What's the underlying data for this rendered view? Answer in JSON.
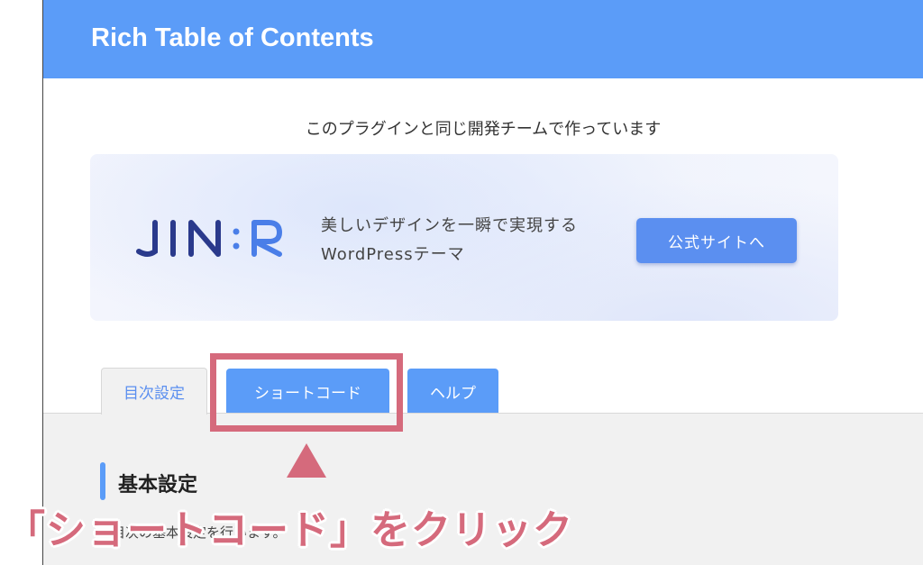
{
  "header": {
    "title": "Rich Table of Contents"
  },
  "promo": {
    "made_by": "このプラグインと同じ開発チームで作っています",
    "logo": {
      "text": "JIN:R",
      "colors": [
        "#2a3a8c",
        "#4a7ee8"
      ]
    },
    "tagline_line1": "美しいデザインを一瞬で実現する",
    "tagline_line2": "WordPressテーマ",
    "button_label": "公式サイトへ"
  },
  "tabs": [
    {
      "label": "目次設定",
      "active": true
    },
    {
      "label": "ショートコード",
      "active": false
    },
    {
      "label": "ヘルプ",
      "active": false
    }
  ],
  "section": {
    "title": "基本設定",
    "description": "目次の基本設定を行います。"
  },
  "annotation": {
    "instruction": "「ショートコード」をクリック",
    "color": "#d56a7c"
  },
  "colors": {
    "header": "#5b9cf8",
    "accent": "#5b8ff0",
    "panel": "#f1f1f1"
  }
}
